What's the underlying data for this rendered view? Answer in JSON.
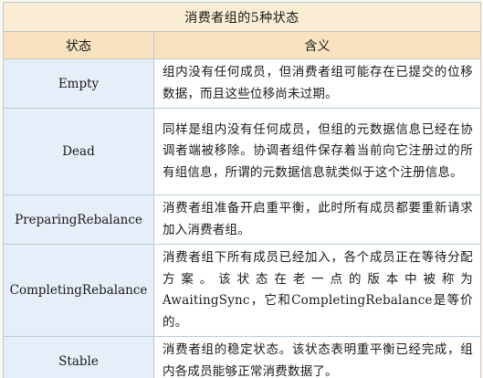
{
  "table": {
    "title": "消费者组的5种状态",
    "headers": {
      "status": "状态",
      "meaning": "含义"
    },
    "rows": [
      {
        "status": "Empty",
        "meaning": "组内没有任何成员，但消费者组可能存在已提交的位移数据，而且这些位移尚未过期。"
      },
      {
        "status": "Dead",
        "meaning": "同样是组内没有任何成员，但组的元数据信息已经在协调者端被移除。协调者组件保存着当前向它注册过的所有组信息，所谓的元数据信息就类似于这个注册信息。"
      },
      {
        "status": "PreparingRebalance",
        "meaning": "消费者组准备开启重平衡，此时所有成员都要重新请求加入消费者组。"
      },
      {
        "status": "CompletingRebalance",
        "meaning": "消费者组下所有成员已经加入，各个成员正在等待分配方案。该状态在老一点的版本中被称为AwaitingSync，它和CompletingRebalance是等价的。"
      },
      {
        "status": "Stable",
        "meaning": "消费者组的稳定状态。该状态表明重平衡已经完成，组内各成员能够正常消费数据了。"
      }
    ]
  }
}
